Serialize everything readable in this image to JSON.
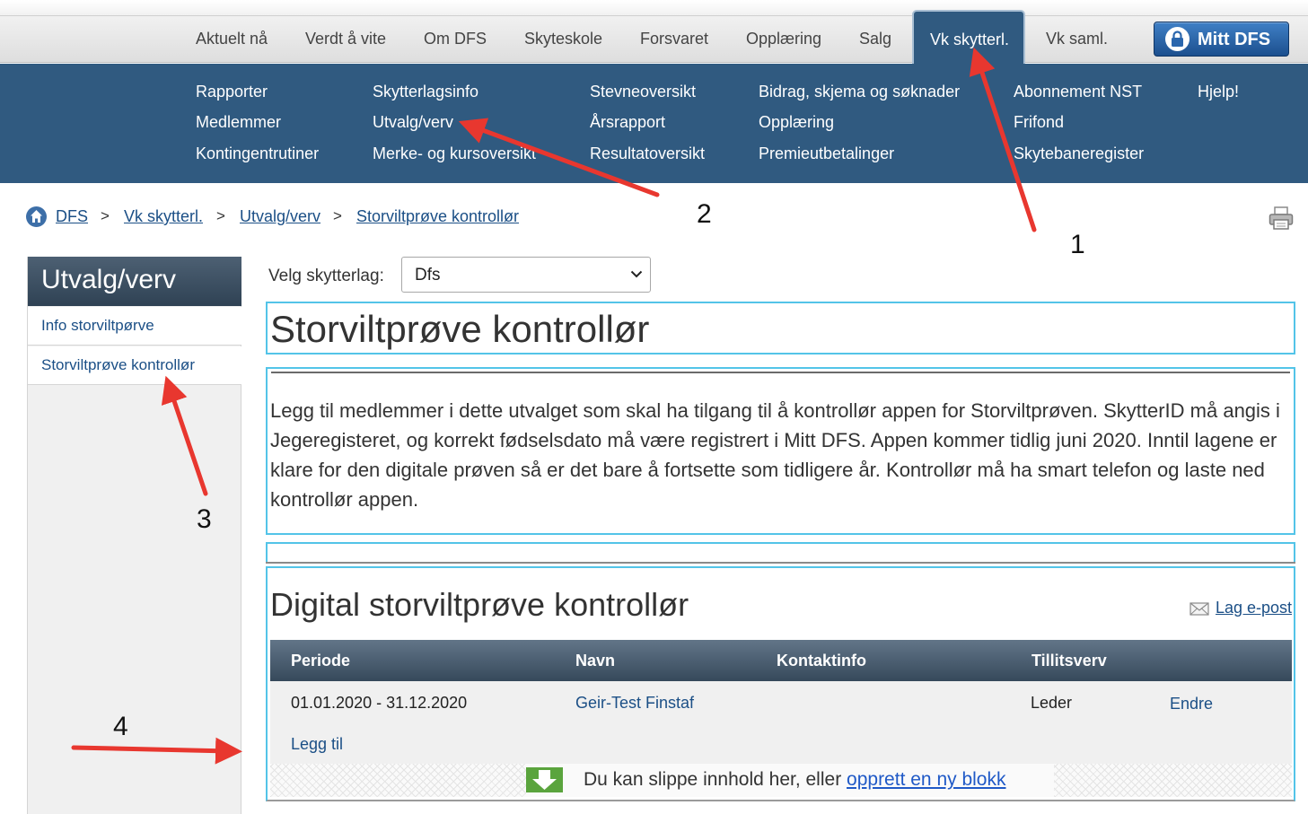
{
  "topnav": {
    "items": [
      "Aktuelt nå",
      "Verdt å vite",
      "Om DFS",
      "Skyteskole",
      "Forsvaret",
      "Opplæring",
      "Salg"
    ],
    "active": "Vk skytterl.",
    "after_active": "Vk saml.",
    "account_button": "Mitt DFS",
    "icons": {
      "account": "lock-icon"
    }
  },
  "megamenu": {
    "columns": [
      [
        "Rapporter",
        "Medlemmer",
        "Kontingentrutiner"
      ],
      [
        "Skytterlagsinfo",
        "Utvalg/verv",
        "Merke- og kursoversikt"
      ],
      [
        "Stevneoversikt",
        "Årsrapport",
        "Resultatoversikt"
      ],
      [
        "Bidrag, skjema og søknader",
        "Opplæring",
        "Premieutbetalinger"
      ],
      [
        "Abonnement NST",
        "Frifond",
        "Skytebaneregister"
      ],
      [
        "Hjelp!"
      ]
    ]
  },
  "breadcrumb": [
    "DFS",
    "Vk skytterl.",
    "Utvalg/verv",
    "Storviltprøve kontrollør"
  ],
  "breadcrumb_separator": ">",
  "sidebar": {
    "title": "Utvalg/verv",
    "items": [
      "Info storviltpørve",
      "Storviltprøve kontrollør"
    ]
  },
  "main": {
    "select_label": "Velg skytterlag:",
    "select_value": "Dfs",
    "title": "Storviltprøve kontrollør",
    "body_text": "Legg til medlemmer i dette utvalget som skal ha tilgang til å kontrollør appen for Storviltprøven. SkytterID må angis i Jegeregisteret, og korrekt fødselsdato må være registrert i Mitt DFS. Appen kommer tidlig juni 2020. Inntil lagene er klare for den digitale prøven så er det bare å fortsette som tidligere år. Kontrollør må ha smart telefon og laste ned kontrollør appen.",
    "section_title": "Digital storviltprøve kontrollør",
    "email_link": "Lag e-post",
    "table": {
      "headers": [
        "Periode",
        "Navn",
        "Kontaktinfo",
        "Tillitsverv"
      ],
      "rows": [
        {
          "periode": "01.01.2020 - 31.12.2020",
          "navn": "Geir-Test Finstaf",
          "kontaktinfo": "",
          "tillitsverv": "Leder",
          "action": "Endre"
        }
      ],
      "add_label": "Legg til"
    },
    "dropzone": {
      "text": "Du kan slippe innhold her, eller",
      "link": "opprett en ny blokk"
    }
  },
  "annotations": {
    "numbers": [
      "1",
      "2",
      "3",
      "4"
    ],
    "arrow_color": "#e8372f"
  },
  "colors": {
    "nav_blue": "#305a80",
    "link_blue": "#1b4f86",
    "frame_cyan": "#53c4e8",
    "account_blue": "#2a66ad"
  }
}
